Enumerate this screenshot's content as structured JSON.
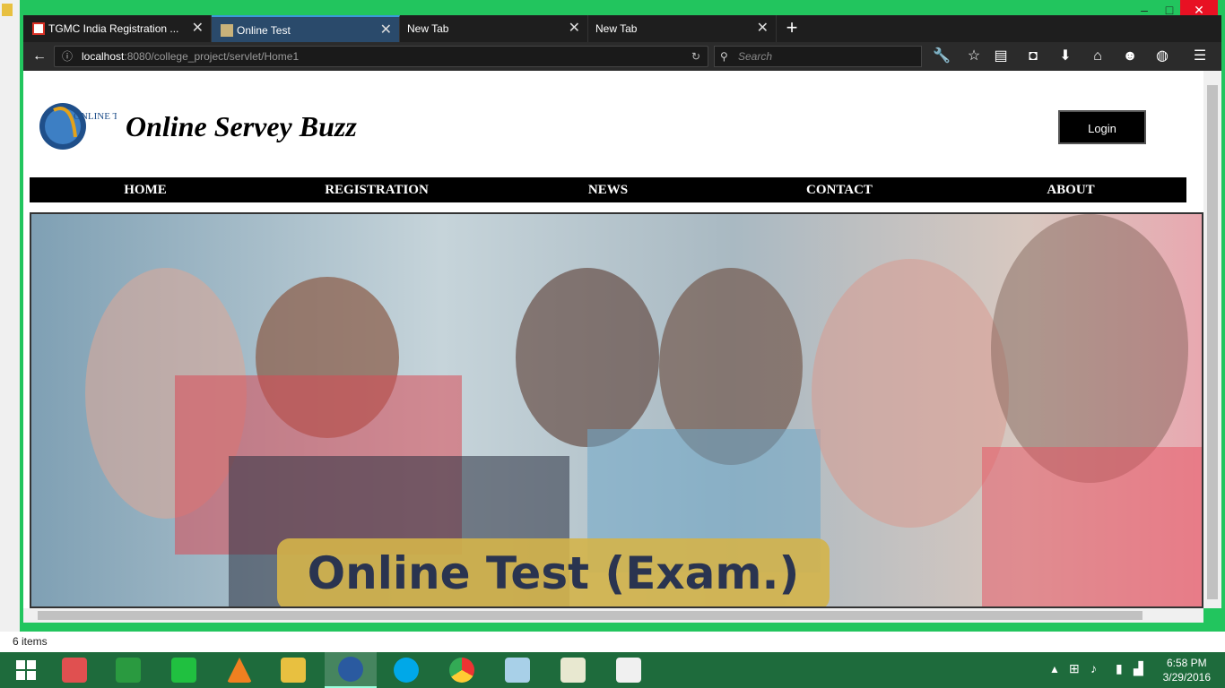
{
  "browser": {
    "tabs": [
      {
        "label": "TGMC India Registration ...",
        "icon": "gmail-icon"
      },
      {
        "label": "Online Test",
        "icon": "page-icon"
      },
      {
        "label": "New Tab"
      },
      {
        "label": "New Tab"
      }
    ],
    "url_host": "localhost",
    "url_path": ":8080/college_project/servlet/Home1",
    "search_placeholder": "Search",
    "window_controls": {
      "minimize": "–",
      "maximize": "□",
      "close": "✕"
    }
  },
  "page": {
    "site_title": "Online Servey Buzz",
    "logo_text": "ONLINE TEST",
    "login_label": "Login",
    "menu": [
      "HOME",
      "REGISTRATION",
      "NEWS",
      "CONTACT",
      "ABOUT"
    ],
    "banner_caption": "Online Test (Exam.)"
  },
  "statusbar": {
    "items_text": "6 items"
  },
  "taskbar": {
    "time": "6:58 PM",
    "date": "3/29/2016"
  }
}
